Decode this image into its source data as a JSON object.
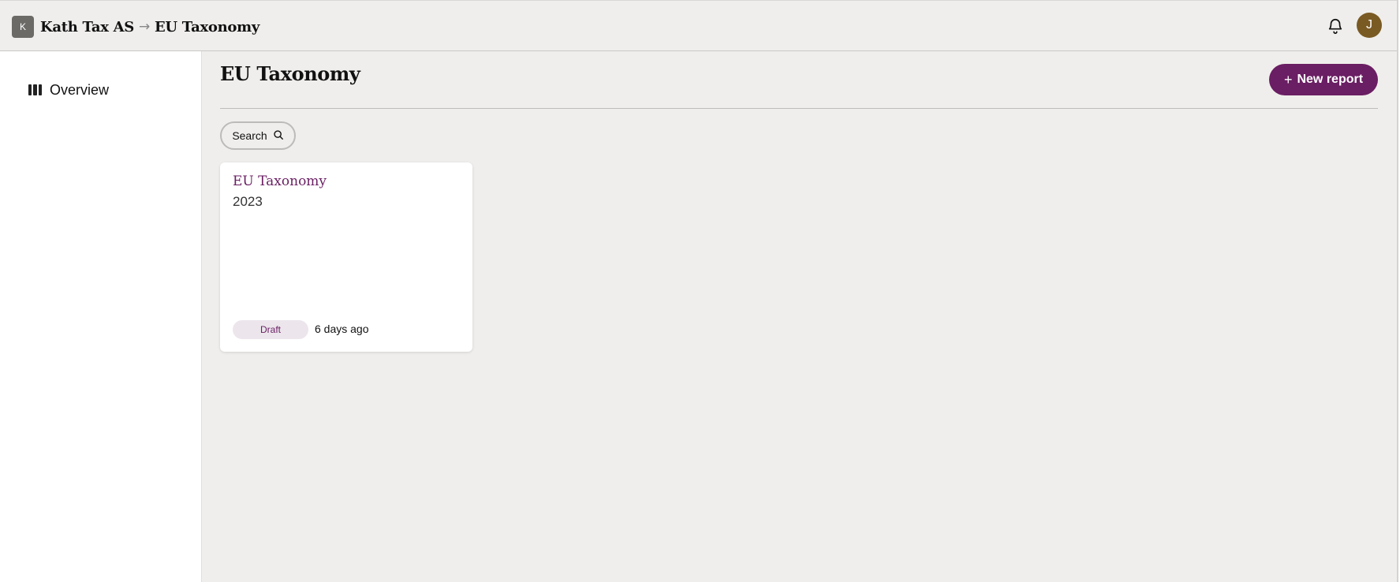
{
  "header": {
    "org_initial": "K",
    "breadcrumb": [
      "Kath Tax AS",
      "EU Taxonomy"
    ],
    "separator": "→",
    "bell_icon": "bell-icon",
    "avatar_initial": "J",
    "colors": {
      "avatar": "#7a5a23",
      "org_badge": "#6b6a67"
    }
  },
  "sidebar": {
    "items": [
      {
        "label": "Overview",
        "icon": "columns-icon"
      }
    ]
  },
  "main": {
    "title": "EU Taxonomy",
    "new_report_label": "New report",
    "search_label": "Search",
    "reports": [
      {
        "title": "EU Taxonomy",
        "year": "2023",
        "status": "Draft",
        "updated": "6 days ago"
      }
    ]
  },
  "colors": {
    "accent": "#6a1e63",
    "background": "#efeeec",
    "badge_bg": "#ece6ec"
  }
}
